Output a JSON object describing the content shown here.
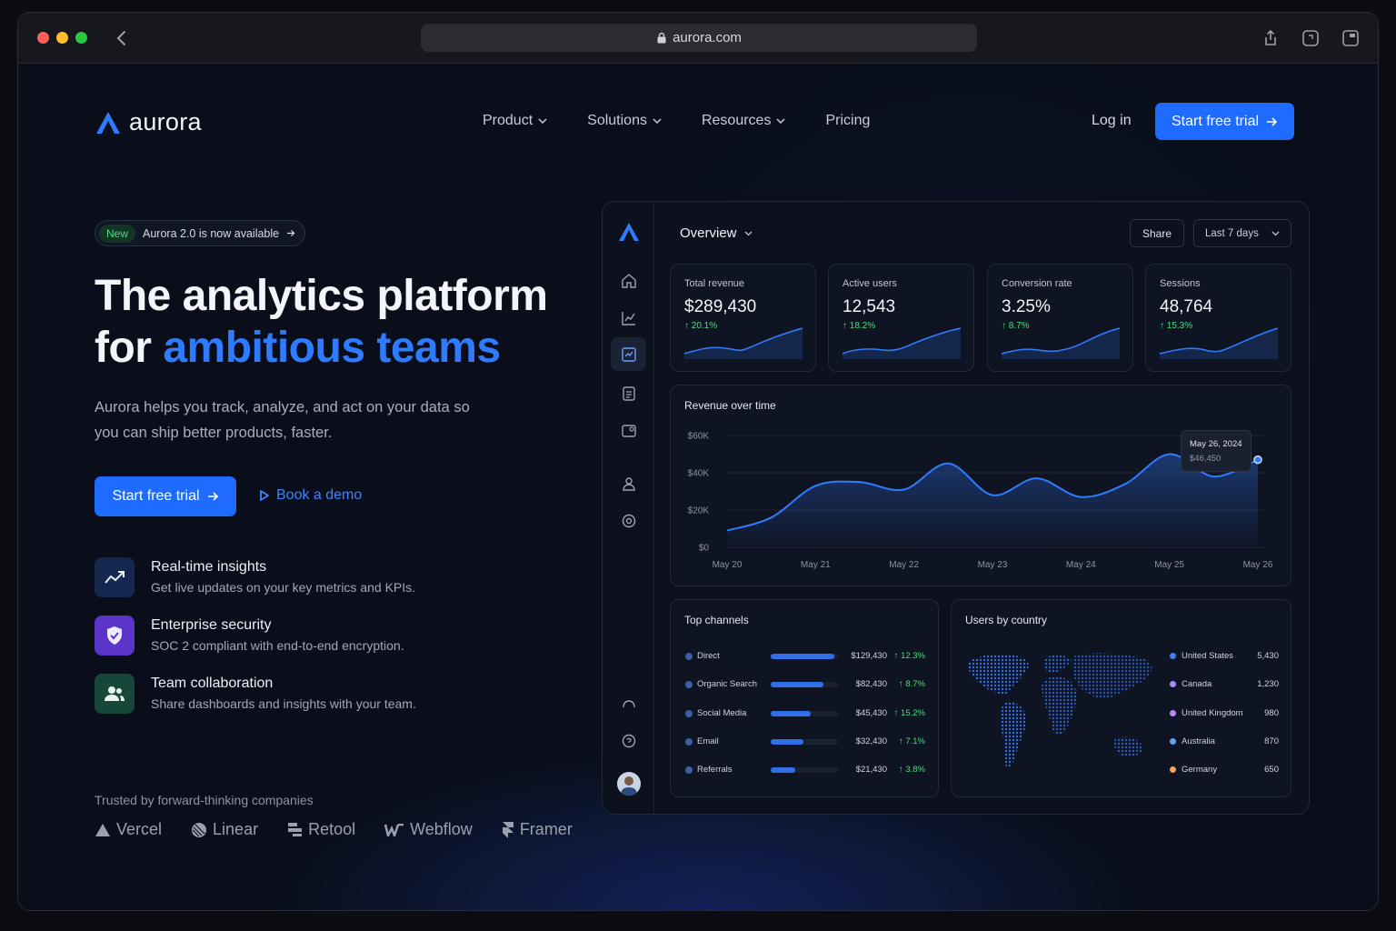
{
  "browser": {
    "url": "aurora.com"
  },
  "nav": {
    "brand": "aurora",
    "menu": [
      "Product",
      "Solutions",
      "Resources",
      "Pricing"
    ],
    "login": "Log in",
    "cta": "Start free trial"
  },
  "hero": {
    "badge_new": "New",
    "badge_text": "Aurora 2.0 is now available",
    "title_line1": "The analytics platform",
    "title_for": "for",
    "title_accent": "ambitious teams",
    "subtitle": "Aurora helps you track, analyze, and act on your data so you can ship better products, faster.",
    "cta_primary": "Start free trial",
    "cta_secondary": "Book a demo"
  },
  "features": [
    {
      "icon": "trend-icon",
      "title": "Real-time insights",
      "desc": "Get live updates on your key metrics and KPIs.",
      "color": "#1c3a78"
    },
    {
      "icon": "shield-icon",
      "title": "Enterprise security",
      "desc": "SOC 2 compliant with end-to-end encryption.",
      "color": "#5b34c9"
    },
    {
      "icon": "users-icon",
      "title": "Team collaboration",
      "desc": "Share dashboards and insights with your team.",
      "color": "#1b5a4a"
    }
  ],
  "trusted": {
    "label": "Trusted by forward-thinking companies",
    "logos": [
      "Vercel",
      "Linear",
      "Retool",
      "Webflow",
      "Framer"
    ]
  },
  "dashboard": {
    "view": "Overview",
    "share": "Share",
    "range": "Last 7 days",
    "kpis": [
      {
        "label": "Total revenue",
        "value": "$289,430",
        "change": "20.1%"
      },
      {
        "label": "Active users",
        "value": "12,543",
        "change": "18.2%"
      },
      {
        "label": "Conversion rate",
        "value": "3.25%",
        "change": "8.7%"
      },
      {
        "label": "Sessions",
        "value": "48,764",
        "change": "15.3%"
      }
    ],
    "revenue": {
      "title": "Revenue over time",
      "tooltip_date": "May 26, 2024",
      "tooltip_value": "$46,450",
      "y_ticks": [
        "$60K",
        "$40K",
        "$20K",
        "$0"
      ],
      "x_ticks": [
        "May 20",
        "May 21",
        "May 22",
        "May 23",
        "May 24",
        "May 25",
        "May 26"
      ]
    },
    "channels": {
      "title": "Top channels",
      "rows": [
        {
          "name": "Direct",
          "value": "$129,430",
          "change": "12.3%",
          "share": 0.95
        },
        {
          "name": "Organic Search",
          "value": "$82,430",
          "change": "8.7%",
          "share": 0.78
        },
        {
          "name": "Social Media",
          "value": "$45,430",
          "change": "15.2%",
          "share": 0.6
        },
        {
          "name": "Email",
          "value": "$32,430",
          "change": "7.1%",
          "share": 0.49
        },
        {
          "name": "Referrals",
          "value": "$21,430",
          "change": "3.8%",
          "share": 0.37
        }
      ]
    },
    "countries": {
      "title": "Users by country",
      "rows": [
        {
          "name": "United States",
          "value": "5,430",
          "color": "#3b82f6"
        },
        {
          "name": "Canada",
          "value": "1,230",
          "color": "#a78bfa"
        },
        {
          "name": "United Kingdom",
          "value": "980",
          "color": "#c084fc"
        },
        {
          "name": "Australia",
          "value": "870",
          "color": "#60a5fa"
        },
        {
          "name": "Germany",
          "value": "650",
          "color": "#f5a25a"
        }
      ]
    }
  },
  "chart_data": {
    "type": "area",
    "title": "Revenue over time",
    "x": [
      "May 20",
      "May 20.5",
      "May 21",
      "May 21.5",
      "May 22",
      "May 22.5",
      "May 23",
      "May 23.5",
      "May 24",
      "May 24.5",
      "May 25",
      "May 25.5",
      "May 26"
    ],
    "values": [
      9000,
      16000,
      33000,
      35000,
      31000,
      45000,
      28000,
      37000,
      27000,
      34000,
      50000,
      38000,
      47000
    ],
    "ylim": [
      0,
      60000
    ],
    "x_labels": [
      "May 20",
      "May 21",
      "May 22",
      "May 23",
      "May 24",
      "May 25",
      "May 26"
    ]
  }
}
